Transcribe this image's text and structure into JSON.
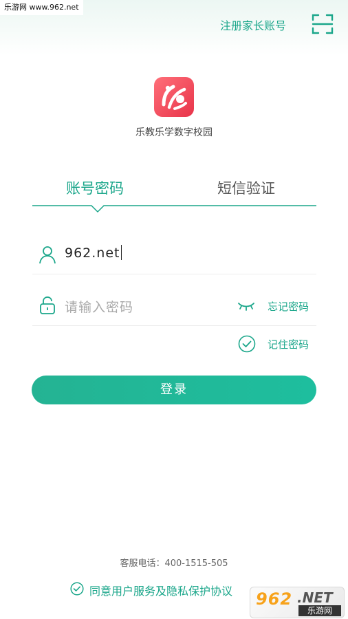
{
  "watermark": {
    "top_text": "乐游网 www.962.net",
    "logo_text": "962",
    "logo_suffix": ".NET",
    "logo_name": "乐游网"
  },
  "header": {
    "register_link": "注册家长账号",
    "scan_icon": "scan-icon"
  },
  "app": {
    "name": "乐教乐学数字校园",
    "logo_icon": "app-logo-icon"
  },
  "tabs": [
    {
      "label": "账号密码",
      "active": true
    },
    {
      "label": "短信验证",
      "active": false
    }
  ],
  "form": {
    "username_value": "962.net",
    "password_placeholder": "请输入密码",
    "forgot_password": "忘记密码",
    "remember_password": "记住密码",
    "remember_checked": true,
    "login_button": "登录"
  },
  "footer": {
    "hotline": "客服电话：400-1515-505",
    "agreement": "同意用户服务及隐私保护协议",
    "agreement_checked": true
  },
  "colors": {
    "accent": "#1aa68a",
    "button": "#21b798",
    "logo": "#ef4a5b"
  }
}
